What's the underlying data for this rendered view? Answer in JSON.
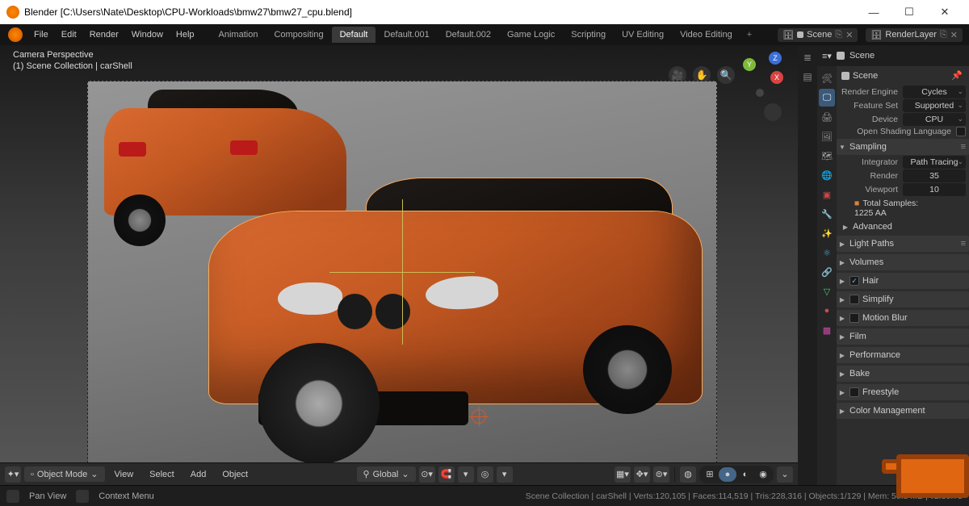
{
  "title": "Blender [C:\\Users\\Nate\\Desktop\\CPU-Workloads\\bmw27\\bmw27_cpu.blend]",
  "menu": {
    "file": "File",
    "edit": "Edit",
    "render": "Render",
    "window": "Window",
    "help": "Help"
  },
  "workspaces": [
    "Animation",
    "Compositing",
    "Default",
    "Default.001",
    "Default.002",
    "Game Logic",
    "Scripting",
    "UV Editing",
    "Video Editing"
  ],
  "ws_active": "Default",
  "scene_field": "Scene",
  "layer_field": "RenderLayer",
  "viewport": {
    "perspective": "Camera Perspective",
    "collection": "(1) Scene Collection | carShell",
    "axes": {
      "x": "X",
      "y": "Y",
      "z": "Z"
    }
  },
  "header3d": {
    "mode": "Object Mode",
    "view": "View",
    "select": "Select",
    "add": "Add",
    "object": "Object",
    "orient": "Global"
  },
  "timeline": {
    "pan": "Pan View",
    "ctx": "Context Menu"
  },
  "props": {
    "scene": "Scene",
    "engine_lbl": "Render Engine",
    "engine": "Cycles",
    "feature_lbl": "Feature Set",
    "feature": "Supported",
    "device_lbl": "Device",
    "device": "CPU",
    "osl": "Open Shading Language",
    "sampling": "Sampling",
    "integrator_lbl": "Integrator",
    "integrator": "Path Tracing",
    "render_lbl": "Render",
    "render": "35",
    "viewport_lbl": "Viewport",
    "viewport": "10",
    "total": "Total Samples:\n1225 AA",
    "advanced": "Advanced",
    "lightpaths": "Light Paths",
    "volumes": "Volumes",
    "hair": "Hair",
    "simplify": "Simplify",
    "motionblur": "Motion Blur",
    "film": "Film",
    "performance": "Performance",
    "bake": "Bake",
    "freestyle": "Freestyle",
    "color": "Color Management"
  },
  "status": {
    "text": "Scene Collection | carShell | Verts:120,105 | Faces:114,519 | Tris:228,316 | Objects:1/129 | Mem: 50.8 MB | v2.80.75"
  }
}
